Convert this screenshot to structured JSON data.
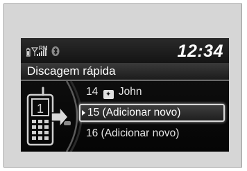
{
  "status": {
    "clock": "12:34",
    "rm_label": "RM",
    "icons": [
      "battery-icon",
      "signal-icon",
      "bluetooth-icon"
    ]
  },
  "title": "Discagem rápida",
  "items": [
    {
      "label": "14",
      "name": "John",
      "has_contact_icon": true,
      "selected": false
    },
    {
      "label": "15 (Adicionar novo)",
      "selected": true
    },
    {
      "label": "16 (Adicionar novo)",
      "selected": false
    }
  ],
  "phone_slot": "1",
  "colors": {
    "screen": "#0a0a0a",
    "highlight_border": "#d8d8d8",
    "frame": "#d6d6d6"
  }
}
